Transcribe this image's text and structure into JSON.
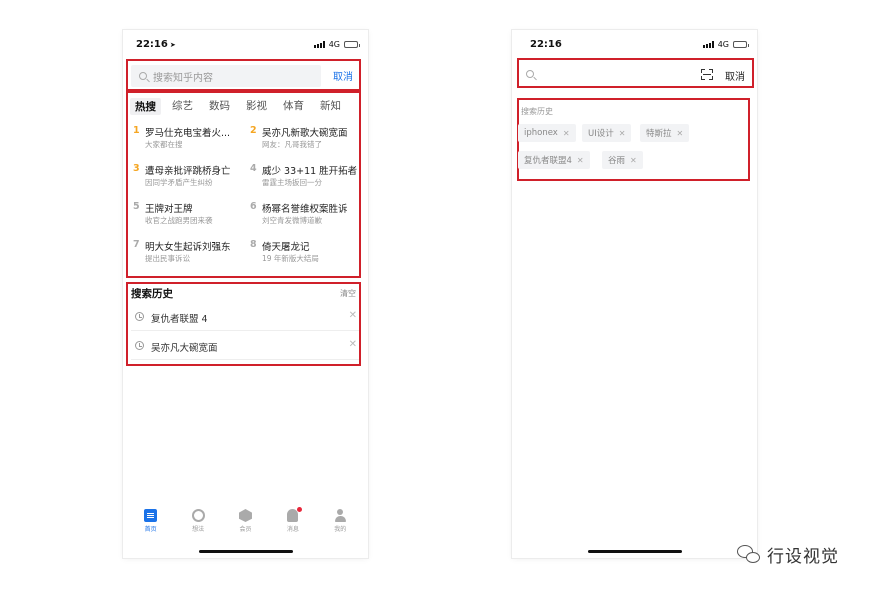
{
  "left_screen": {
    "status": {
      "time": "22:16",
      "network": "4G"
    },
    "search": {
      "placeholder": "搜索知乎内容",
      "cancel_label": "取消"
    },
    "category_tabs": [
      "热搜",
      "综艺",
      "数码",
      "影视",
      "体育",
      "新知"
    ],
    "hot_list": [
      {
        "rank": "1",
        "title": "罗马仕充电宝着火...",
        "subtitle": "大家都在搜"
      },
      {
        "rank": "2",
        "title": "吴亦凡新歌大碗宽面",
        "subtitle": "网友：凡哥我错了"
      },
      {
        "rank": "3",
        "title": "遭母亲批评跳桥身亡",
        "subtitle": "因同学矛盾产生纠纷"
      },
      {
        "rank": "4",
        "title": "威少 33+11 胜开拓者",
        "subtitle": "雷霆主场扳回一分"
      },
      {
        "rank": "5",
        "title": "王牌对王牌",
        "subtitle": "收官之战跑男团来袭"
      },
      {
        "rank": "6",
        "title": "杨幂名誉维权案胜诉",
        "subtitle": "刘空青发微博道歉"
      },
      {
        "rank": "7",
        "title": "明大女生起诉刘强东",
        "subtitle": "提出民事诉讼"
      },
      {
        "rank": "8",
        "title": "倚天屠龙记",
        "subtitle": "19 年新版大结局"
      }
    ],
    "history": {
      "title": "搜索历史",
      "clear_label": "清空",
      "items": [
        "复仇者联盟 4",
        "吴亦凡大碗宽面"
      ]
    },
    "tab_bar": [
      {
        "label": "首页",
        "icon": "home-icon"
      },
      {
        "label": "想法",
        "icon": "idea-icon"
      },
      {
        "label": "会员",
        "icon": "member-icon"
      },
      {
        "label": "消息",
        "icon": "bell-icon"
      },
      {
        "label": "我的",
        "icon": "profile-icon"
      }
    ]
  },
  "right_screen": {
    "status": {
      "time": "22:16",
      "network": "4G"
    },
    "search": {
      "cancel_label": "取消"
    },
    "history": {
      "title": "搜索历史",
      "chips": [
        "iphonex",
        "UI设计",
        "特斯拉",
        "复仇者联盟4",
        "谷雨"
      ]
    }
  },
  "watermark": {
    "text": "行设视觉"
  },
  "colors": {
    "accent": "#1a72e8",
    "highlight_box": "#d0202a",
    "rank_top": "#f5a623",
    "badge": "#e8263a"
  }
}
